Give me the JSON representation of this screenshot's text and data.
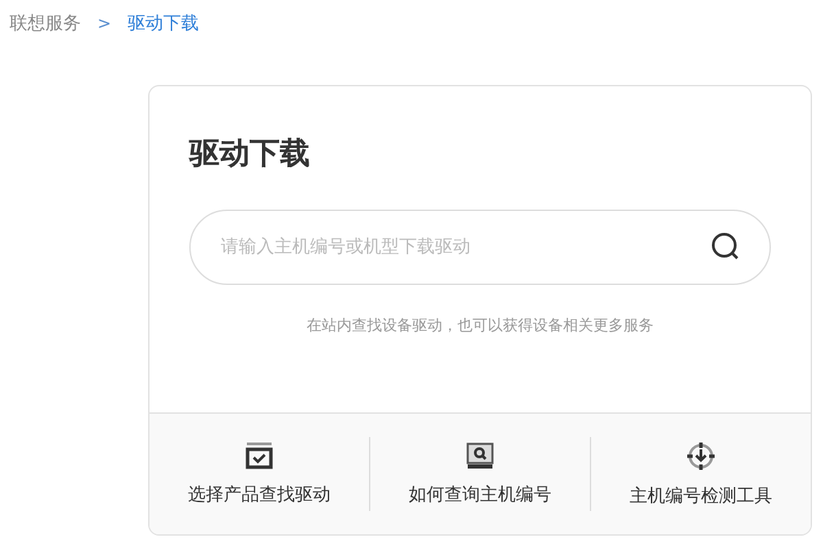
{
  "breadcrumb": {
    "items": [
      {
        "label": "联想服务",
        "selected": false
      },
      {
        "label": "驱动下载",
        "selected": true
      }
    ],
    "separator": ">"
  },
  "card": {
    "title": "驱动下载",
    "search": {
      "placeholder": "请输入主机编号或机型下载驱动"
    },
    "hint": "在站内查找设备驱动，也可以获得设备相关更多服务",
    "links": [
      {
        "kind": "checklist",
        "label": "选择产品查找驱动"
      },
      {
        "kind": "lookup",
        "label": "如何查询主机编号"
      },
      {
        "kind": "detect",
        "label": "主机编号检测工具"
      }
    ]
  }
}
